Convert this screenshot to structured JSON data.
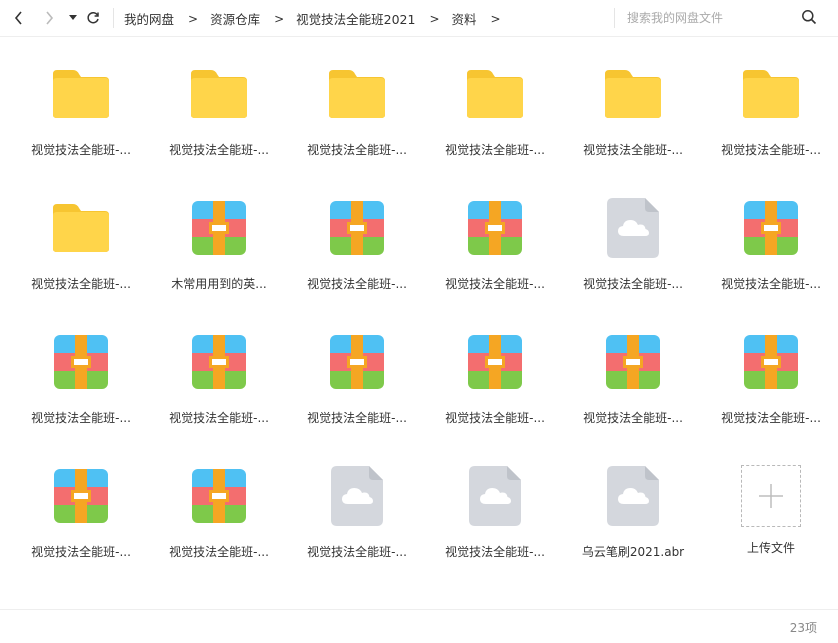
{
  "toolbar": {
    "back_icon": "chevron-left-icon",
    "forward_icon": "chevron-right-icon",
    "history_icon": "caret-down-icon",
    "refresh_icon": "refresh-icon"
  },
  "breadcrumb": {
    "items": [
      "我的网盘",
      "资源仓库",
      "视觉技法全能班2021",
      "资料"
    ],
    "separator": ">"
  },
  "search": {
    "placeholder": "搜索我的网盘文件",
    "value": "",
    "icon": "search-icon"
  },
  "files": [
    {
      "type": "folder",
      "label": "视觉技法全能班-..."
    },
    {
      "type": "folder",
      "label": "视觉技法全能班-..."
    },
    {
      "type": "folder",
      "label": "视觉技法全能班-..."
    },
    {
      "type": "folder",
      "label": "视觉技法全能班-..."
    },
    {
      "type": "folder",
      "label": "视觉技法全能班-..."
    },
    {
      "type": "folder",
      "label": "视觉技法全能班-..."
    },
    {
      "type": "folder",
      "label": "视觉技法全能班-..."
    },
    {
      "type": "archive",
      "label": "木常用用到的英..."
    },
    {
      "type": "archive",
      "label": "视觉技法全能班-..."
    },
    {
      "type": "archive",
      "label": "视觉技法全能班-..."
    },
    {
      "type": "cloud-file",
      "label": "视觉技法全能班-..."
    },
    {
      "type": "archive",
      "label": "视觉技法全能班-..."
    },
    {
      "type": "archive",
      "label": "视觉技法全能班-..."
    },
    {
      "type": "archive",
      "label": "视觉技法全能班-..."
    },
    {
      "type": "archive",
      "label": "视觉技法全能班-..."
    },
    {
      "type": "archive",
      "label": "视觉技法全能班-..."
    },
    {
      "type": "archive",
      "label": "视觉技法全能班-..."
    },
    {
      "type": "archive",
      "label": "视觉技法全能班-..."
    },
    {
      "type": "archive",
      "label": "视觉技法全能班-..."
    },
    {
      "type": "archive",
      "label": "视觉技法全能班-..."
    },
    {
      "type": "cloud-file",
      "label": "视觉技法全能班-..."
    },
    {
      "type": "cloud-file",
      "label": "视觉技法全能班-..."
    },
    {
      "type": "cloud-file",
      "label": "乌云笔刷2021.abr"
    },
    {
      "type": "upload",
      "label": "上传文件"
    }
  ],
  "footer": {
    "count": "23项"
  },
  "colors": {
    "folder": "#ffd54a",
    "folder_tab": "#f7c531",
    "archive_blue": "#4fc1f3",
    "archive_red": "#f36e6f",
    "archive_green": "#7ec94a",
    "archive_belt": "#f5a623",
    "cloud_file": "#d4d7dd"
  }
}
